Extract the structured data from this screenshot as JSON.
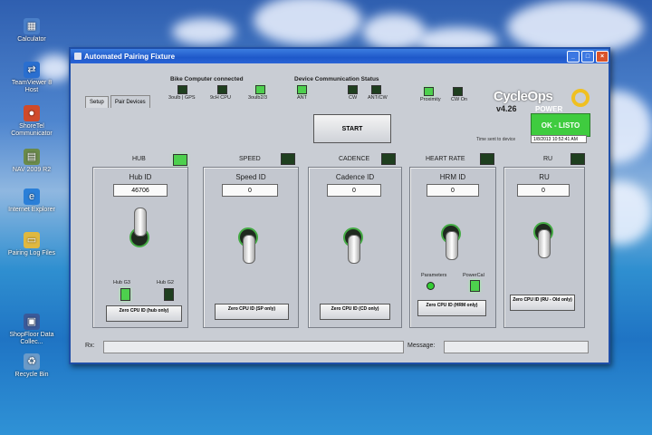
{
  "desktop": {
    "icons": [
      {
        "label": "Calculator",
        "glyph": "▦",
        "color": "#4a7fc8"
      },
      {
        "label": "TeamViewer 8 Host",
        "glyph": "⇄",
        "color": "#2a6fd0"
      },
      {
        "label": "ShoreTel Communicator",
        "glyph": "●",
        "color": "#d04a2a"
      },
      {
        "label": "NAV 2009 R2",
        "glyph": "▤",
        "color": "#6a8a4a"
      },
      {
        "label": "Internet Explorer",
        "glyph": "e",
        "color": "#2a7fd8"
      },
      {
        "label": "Pairing Log Files",
        "glyph": "▭",
        "color": "#e0b840"
      },
      {
        "label": "ShopFloor Data Collec...",
        "glyph": "▣",
        "color": "#3a5a9a"
      },
      {
        "label": "Recycle Bin",
        "glyph": "♻",
        "color": "#6a9ac8"
      }
    ]
  },
  "window": {
    "title": "Automated Pairing Fixture",
    "tabs": [
      "Setup",
      "Pair Devices"
    ],
    "bike_computer_label": "Bike Computer connected",
    "device_comm_label": "Device Communication Status",
    "bike_leds": [
      "3oulb | GPS",
      "9cH CPU",
      "3oulb2/3"
    ],
    "comm_leds": [
      "ANT",
      "CW",
      "ANT/CW"
    ],
    "status_leds": [
      "Proximity",
      "CW On"
    ],
    "logo": "CycleOps",
    "logo_sub": "POWER",
    "version": "v4.26",
    "start_label": "START",
    "ok_label": "OK - LISTO",
    "time_label": "Time sent to device",
    "time_value": "1/8/2013 10:52:41 AM",
    "message_label": "Message:",
    "rx_label": "Rx:"
  },
  "sections": [
    {
      "title": "HUB",
      "id_label": "Hub ID",
      "id_value": "46706",
      "button": "Zero CPU ID (hub only)",
      "led_on": true
    },
    {
      "title": "SPEED",
      "id_label": "Speed ID",
      "id_value": "0",
      "button": "Zero CPU ID (SP only)",
      "led_on": false
    },
    {
      "title": "CADENCE",
      "id_label": "Cadence ID",
      "id_value": "0",
      "button": "Zero CPU ID (CD only)",
      "led_on": false
    },
    {
      "title": "HEART RATE",
      "id_label": "HRM ID",
      "id_value": "0",
      "button": "Zero CPU ID (HRM only)",
      "led_on": false
    },
    {
      "title": "RU",
      "id_label": "RU",
      "id_value": "0",
      "button": "Zero CPU ID (RU - Old only)",
      "led_on": false
    }
  ],
  "hub_sub": [
    "Hub G3",
    "Hub G2"
  ],
  "hr_sub": [
    "Parameters",
    "PowerCal"
  ]
}
